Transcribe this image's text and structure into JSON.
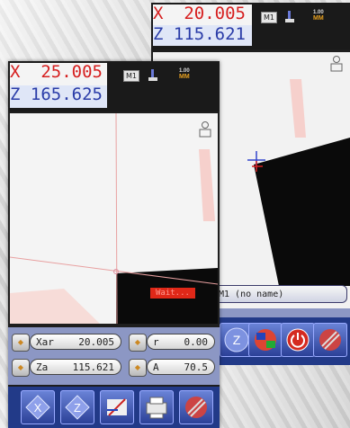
{
  "back_device": {
    "coords": {
      "x_label": "X",
      "x_value": "20.005",
      "z_label": "Z",
      "z_value": "115.621"
    },
    "header": {
      "mode_badge": "M1",
      "scale_value": "1.00",
      "scale_unit": "MM"
    },
    "name_field": "M1 (no name)",
    "toolbar_icons": [
      "z-icon",
      "flags-icon",
      "power-icon",
      "stripes-icon"
    ]
  },
  "front_device": {
    "coords": {
      "x_label": "X",
      "x_value": "25.005",
      "z_label": "Z",
      "z_value": "165.625"
    },
    "header": {
      "mode_badge": "M1",
      "scale_value": "1.00",
      "scale_unit": "MM"
    },
    "status_label": "Wait...",
    "fields": [
      {
        "label": "Xar",
        "value": "20.005"
      },
      {
        "label": "r",
        "value": "0.00"
      },
      {
        "label": "Za",
        "value": "115.621"
      },
      {
        "label": "A",
        "value": "70.5"
      }
    ],
    "toolbar_icons": [
      "x-icon",
      "z-icon",
      "tool-icon",
      "printer-icon",
      "stripes-icon"
    ]
  },
  "colors": {
    "x_red": "#d62020",
    "z_blue": "#2a3ca8",
    "panel": "#8c97c4",
    "toolbar": "#223a88",
    "status": "#e02818"
  }
}
